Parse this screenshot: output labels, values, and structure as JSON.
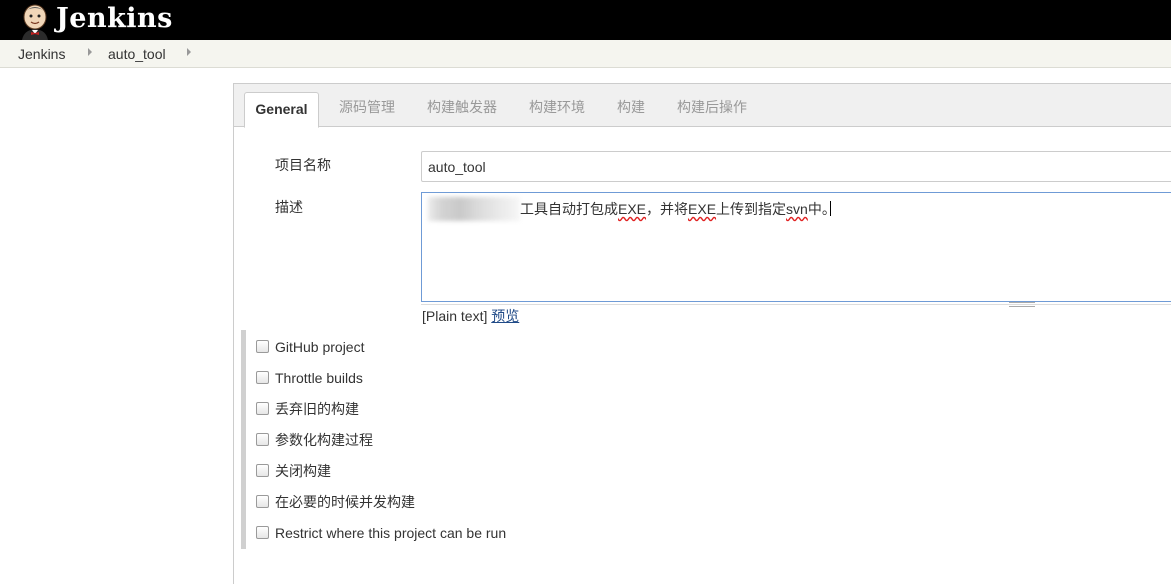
{
  "header": {
    "title": "Jenkins",
    "logo_icon": "jenkins-butler-icon"
  },
  "breadcrumb": {
    "items": [
      "Jenkins",
      "auto_tool"
    ]
  },
  "tabs": [
    {
      "label": "General",
      "active": true
    },
    {
      "label": "源码管理"
    },
    {
      "label": "构建触发器"
    },
    {
      "label": "构建环境"
    },
    {
      "label": "构建"
    },
    {
      "label": "构建后操作"
    }
  ],
  "form": {
    "name_label": "项目名称",
    "name_value": "auto_tool",
    "desc_label": "描述",
    "desc_value_prefix": "工具自动打包成",
    "desc_value_exe1": "EXE",
    "desc_value_mid": "，并将",
    "desc_value_exe2": "EXE",
    "desc_value_mid2": "上传到指定",
    "desc_value_svn": "svn",
    "desc_value_suffix": "中。",
    "format_label": "[Plain text]",
    "preview_link": "预览"
  },
  "options": [
    {
      "label": "GitHub project",
      "checked": false
    },
    {
      "label": "Throttle builds",
      "checked": false
    },
    {
      "label": "丢弃旧的构建",
      "checked": false
    },
    {
      "label": "参数化构建过程",
      "checked": false
    },
    {
      "label": "关闭构建",
      "checked": false
    },
    {
      "label": "在必要的时候并发构建",
      "checked": false
    },
    {
      "label": "Restrict where this project can be run",
      "checked": false
    }
  ],
  "colors": {
    "header_bg": "#000000",
    "breadcrumb_bg": "#f5f5ef",
    "link": "#204a87",
    "focus_border": "#6f9bd6"
  }
}
